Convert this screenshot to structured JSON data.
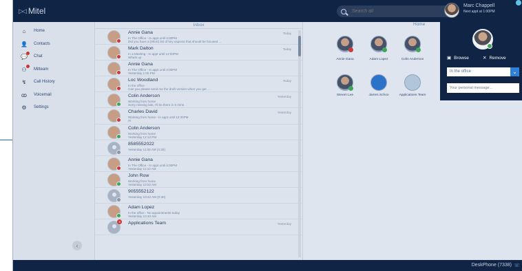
{
  "app": {
    "name": "Mitel"
  },
  "search": {
    "placeholder": "Search all",
    "clear": "✕"
  },
  "me": {
    "name": "Marc Chappell",
    "status": "Next appt at 1:00PM"
  },
  "sidebar": {
    "items": [
      {
        "label": "Home",
        "icon": "home-icon",
        "glyph": "⌂"
      },
      {
        "label": "Contacts",
        "icon": "contacts-icon",
        "glyph": "👤"
      },
      {
        "label": "Chat",
        "icon": "chat-icon",
        "glyph": "💬"
      },
      {
        "label": "Mitteam",
        "icon": "team-icon",
        "glyph": "⚇"
      },
      {
        "label": "Call History",
        "icon": "call-history-icon",
        "glyph": "↯"
      },
      {
        "label": "Voicemail",
        "icon": "voicemail-icon",
        "glyph": "ꝏ"
      },
      {
        "label": "Settings",
        "icon": "settings-icon",
        "glyph": "⚙"
      }
    ],
    "collapse": "‹"
  },
  "inbox": {
    "title": "Inbox",
    "rows": [
      {
        "name": "Annie Gana",
        "line1": "In The Office - In appt until 4:00PM",
        "line2": "Did you have a (short) list of key aspects that should be focused ...",
        "time": "Today",
        "status": "red",
        "avatar": "photo"
      },
      {
        "name": "Mark Dalton",
        "line1": "In a Meeting - In appt until 12:00PM",
        "line2": "Whats up",
        "time": "Today",
        "status": "red",
        "avatar": "photo"
      },
      {
        "name": "Annie Gana",
        "line1": "In The Office - In appt until 4:00PM",
        "line2": "Yesterday 1:00 PM",
        "time": "",
        "status": "red",
        "avatar": "photo"
      },
      {
        "name": "Loc Woodland",
        "line1": "In the office",
        "line2": "Can you please send me the draft version when you get ...",
        "time": "Today",
        "status": "red",
        "avatar": "photo"
      },
      {
        "name": "Colin Anderson",
        "line1": "Working from home",
        "line2": "Sorry missing late, I'll be there in 5 mins",
        "time": "Yesterday",
        "status": "green",
        "avatar": "photo"
      },
      {
        "name": "Charles David",
        "line1": "Working from home - In appt until 12:30PM",
        "line2": "Hi",
        "time": "Yesterday",
        "status": "red",
        "avatar": "photo"
      },
      {
        "name": "Colin Anderson",
        "line1": "Working from home",
        "line2": "Yesterday 12:12 PM",
        "time": "",
        "status": "green",
        "avatar": "photo"
      },
      {
        "name": "8585552022",
        "line1": "Yesterday 11:08 AM (4:30)",
        "line2": "",
        "time": "",
        "status": "grayst",
        "avatar": "gray"
      },
      {
        "name": "Annie Gana",
        "line1": "In The Office - In appt until 4:00PM",
        "line2": "Yesterday 11:10 AM",
        "time": "",
        "status": "red",
        "avatar": "photo"
      },
      {
        "name": "John Row",
        "line1": "Working from home",
        "line2": "Yesterday 10:52 AM",
        "time": "",
        "status": "green",
        "avatar": "photo"
      },
      {
        "name": "9055552122",
        "line1": "Yesterday 10:42 AM (0:30)",
        "line2": "",
        "time": "",
        "status": "grayst",
        "avatar": "gray"
      },
      {
        "name": "Adam Lopez",
        "line1": "In the office - No appointments today",
        "line2": "Yesterday 10:40 AM",
        "time": "",
        "status": "green",
        "avatar": "photo"
      },
      {
        "name": "Applications Team",
        "line1": "",
        "line2": "",
        "time": "Yesterday",
        "status": "",
        "avatar": "gray",
        "count": "3"
      }
    ]
  },
  "home": {
    "title": "Home",
    "favorites": [
      {
        "label": "",
        "status": "red",
        "type": "person"
      },
      {
        "label": "",
        "status": "green",
        "type": "person"
      },
      {
        "label": "",
        "status": "green",
        "type": "person"
      },
      {
        "label": "Annie Gana",
        "status": "",
        "type": "label"
      },
      {
        "label": "Adam Lopez",
        "status": "",
        "type": "label"
      },
      {
        "label": "Colin Anderson",
        "status": "",
        "type": "label"
      },
      {
        "label": "Steven Lee",
        "status": "green",
        "type": "person"
      },
      {
        "label": "James Schoo",
        "status": "",
        "type": "phone"
      },
      {
        "label": "Applications Team",
        "status": "",
        "type": "team"
      }
    ]
  },
  "popup": {
    "browse": "Browse",
    "remove": "Remove",
    "status_value": "In the office",
    "message_placeholder": "Your personal message..."
  },
  "footer": {
    "device": "DeskPhone (7338)"
  }
}
